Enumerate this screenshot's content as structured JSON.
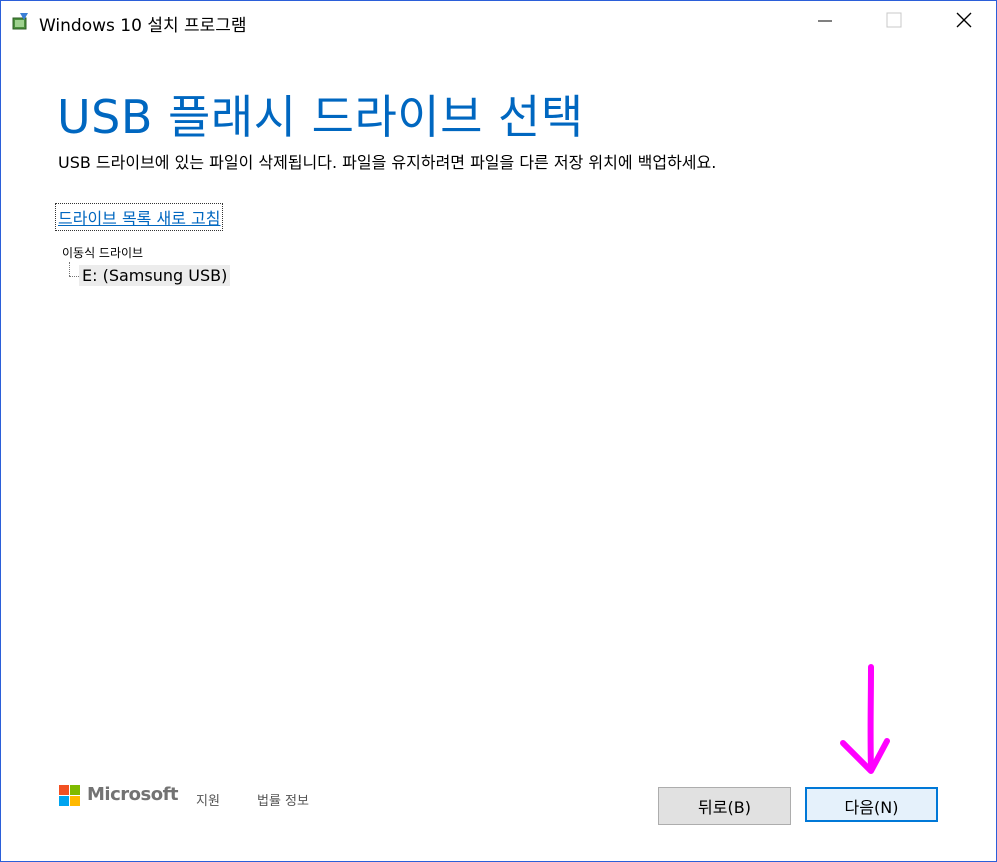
{
  "window": {
    "title": "Windows 10 설치 프로그램",
    "icons": {
      "app": "setup-app-icon",
      "minimize": "minimize-icon",
      "maximize": "maximize-icon",
      "close": "close-icon"
    }
  },
  "main": {
    "heading": "USB 플래시 드라이브 선택",
    "description": "USB 드라이브에 있는 파일이 삭제됩니다. 파일을 유지하려면 파일을 다른 저장 위치에 백업하세요.",
    "refresh_link": "드라이브 목록 새로 고침",
    "drive_tree": {
      "root_label": "이동식 드라이브",
      "items": [
        {
          "label": "E: (Samsung USB)",
          "selected": true
        }
      ]
    }
  },
  "footer": {
    "brand": "Microsoft",
    "support_link": "지원",
    "legal_link": "법률 정보"
  },
  "buttons": {
    "back": "뒤로(B)",
    "next": "다음(N)"
  },
  "annotation": {
    "arrow_color": "#ff00ff",
    "icon": "arrow-down-icon"
  },
  "colors": {
    "accent": "#0067c0",
    "window_border": "#2b5fd9"
  }
}
